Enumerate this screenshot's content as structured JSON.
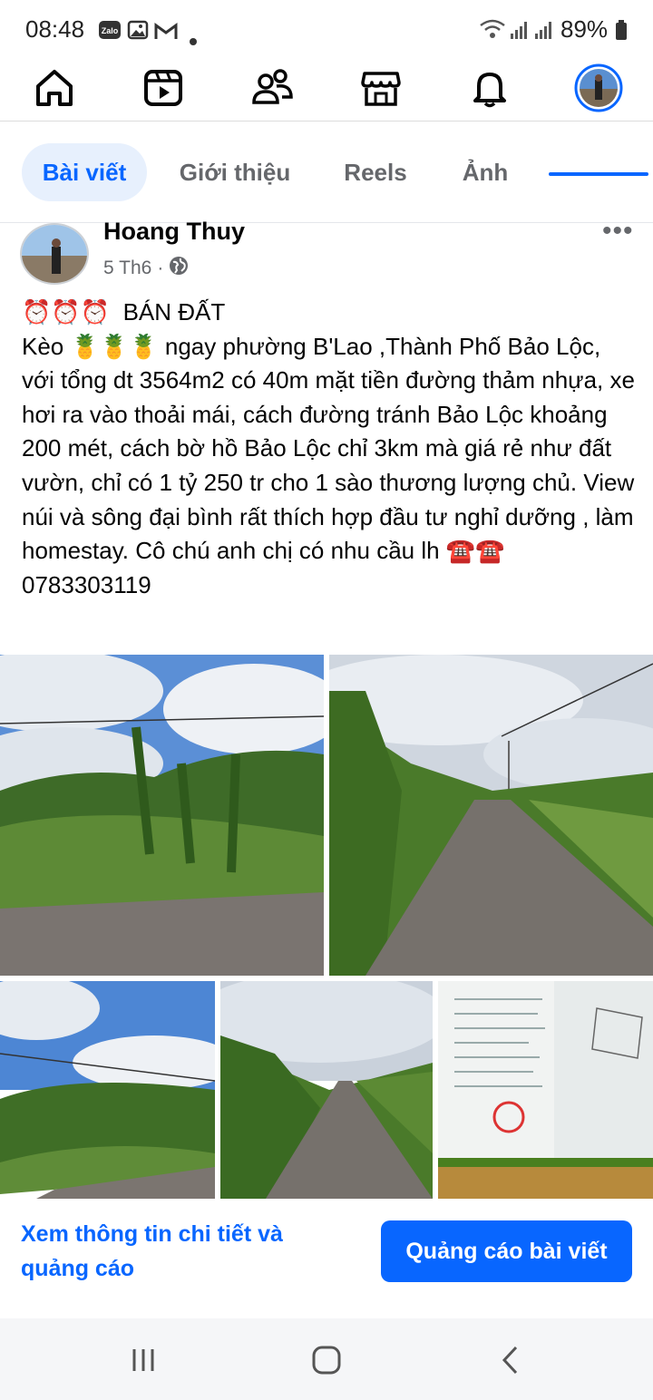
{
  "status_bar": {
    "time": "08:48",
    "notification_icons": [
      "zalo-icon",
      "image-icon",
      "gmail-icon",
      "dot-icon"
    ],
    "right_icons": [
      "wifi-icon",
      "signal-icon",
      "signal-icon"
    ],
    "battery": "89%",
    "zalo_label": "Zalo"
  },
  "top_nav": {
    "items": [
      "home-icon",
      "video-icon",
      "friends-icon",
      "marketplace-icon",
      "bell-icon",
      "profile-avatar"
    ],
    "active_index": 5,
    "accent": "#0866ff"
  },
  "tabs": {
    "items": [
      "Bài viết",
      "Giới thiệu",
      "Reels",
      "Ảnh"
    ],
    "active": "Bài viết"
  },
  "post": {
    "author": "Hoang Thuy",
    "date": "5 Th6",
    "separator": "·",
    "audience_icon": "globe-icon",
    "more": "•••",
    "text_line1_emoji": "⏰⏰⏰",
    "text_line1": "BÁN ĐẤT",
    "text_kèo": "Kèo",
    "text_pineapples": "🍍🍍🍍",
    "text_body": "ngay  phường B'Lao ,Thành Phố Bảo Lộc,  với tổng dt 3564m2 có 40m mặt tiền đường thảm nhựa, xe hơi ra vào thoải mái, cách đường tránh Bảo Lộc khoảng 200 mét, cách bờ hồ Bảo Lộc chỉ 3km mà giá rẻ như đất vườn, chỉ có 1 tỷ 250 tr cho 1 sào thương lượng chủ. View núi và sông đại bình rất thích hợp đầu tư nghỉ dưỡng , làm homestay. Cô chú anh chị có nhu cầu lh",
    "text_phones_emoji": "☎️☎️",
    "phone": "0783303119"
  },
  "cta": {
    "details_link": "Xem thông tin chi tiết và quảng cáo",
    "boost_button": "Quảng cáo bài viết"
  },
  "system_nav": [
    "recents-icon",
    "home-circle-icon",
    "back-icon"
  ]
}
